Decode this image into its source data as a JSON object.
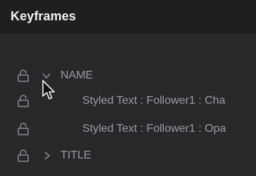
{
  "panel": {
    "title": "Keyframes"
  },
  "rows": [
    {
      "label": "NAME",
      "expanded": true,
      "icon": "lock-icon"
    },
    {
      "label": "Styled Text : Follower1 : Cha",
      "icon": "lock-icon"
    },
    {
      "label": "Styled Text : Follower1 : Opa",
      "icon": "lock-icon"
    },
    {
      "label": "TITLE",
      "expanded": false,
      "icon": "lock-icon"
    }
  ],
  "colors": {
    "header_bg": "#1f1f22",
    "panel_bg": "#28282b",
    "title_text": "#f2f2f2",
    "row_text": "#9c9ca1",
    "icon": "#8a8a8f"
  }
}
